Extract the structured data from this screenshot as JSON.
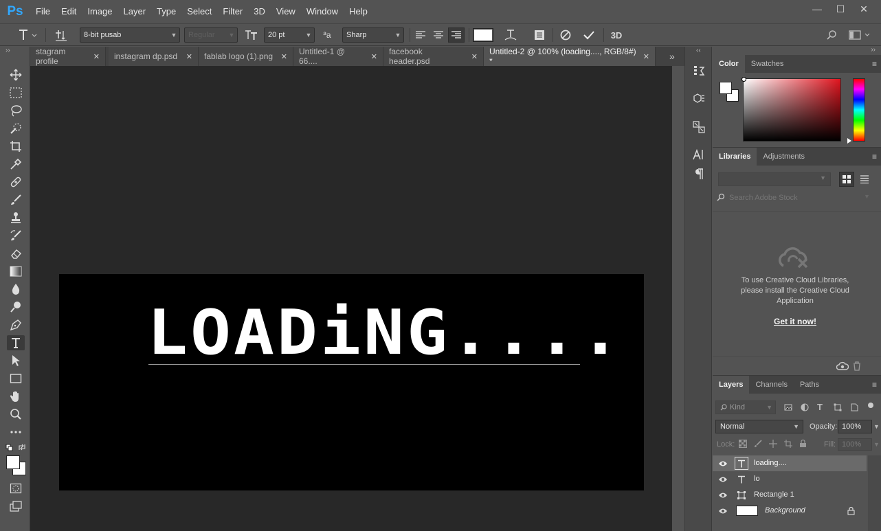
{
  "app": {
    "logo": "Ps"
  },
  "menu": [
    "File",
    "Edit",
    "Image",
    "Layer",
    "Type",
    "Select",
    "Filter",
    "3D",
    "View",
    "Window",
    "Help"
  ],
  "window_controls": {
    "minimize": "—",
    "maximize": "☐",
    "close": "✕"
  },
  "options_bar": {
    "font_family": "8-bit pusab",
    "font_style": "Regular",
    "font_size": "20 pt",
    "antialias_glyph": "ªa",
    "antialias": "Sharp",
    "three_d_label": "3D",
    "text_color": "#ffffff"
  },
  "tabs": [
    {
      "label": "stagram profile",
      "close": "✕"
    },
    {
      "label": "instagram dp.psd",
      "close": "✕"
    },
    {
      "label": "fablab logo (1).png",
      "close": "✕"
    },
    {
      "label": "Untitled-1 @ 66....",
      "close": "✕"
    },
    {
      "label": "facebook header.psd",
      "close": "✕"
    },
    {
      "label": "Untitled-2 @ 100% (loading...., RGB/8#) *",
      "close": "✕"
    }
  ],
  "tabs_overflow": "»",
  "canvas": {
    "text": "LOADiNG....",
    "background": "#000000",
    "text_color": "#ffffff"
  },
  "color_panel": {
    "tabs": [
      "Color",
      "Swatches"
    ],
    "foreground": "#ffffff",
    "background": "#ffffff"
  },
  "libraries_panel": {
    "tabs": [
      "Libraries",
      "Adjustments"
    ],
    "search_placeholder": "Search Adobe Stock",
    "message": "To use Creative Cloud Libraries, please install the Creative Cloud Application",
    "link": "Get it now!"
  },
  "layers_panel": {
    "tabs": [
      "Layers",
      "Channels",
      "Paths"
    ],
    "filter_kind": "Kind",
    "blend_mode": "Normal",
    "opacity_label": "Opacity:",
    "opacity": "100%",
    "lock_label": "Lock:",
    "fill_label": "Fill:",
    "fill": "100%",
    "layers": [
      {
        "name": "loading....",
        "type": "text",
        "selected": true
      },
      {
        "name": "lo",
        "type": "text",
        "selected": false
      },
      {
        "name": "Rectangle 1",
        "type": "shape",
        "selected": false
      },
      {
        "name": "Background",
        "type": "background",
        "selected": false
      }
    ]
  },
  "collapse_left": "››",
  "collapse_right": "‹‹"
}
